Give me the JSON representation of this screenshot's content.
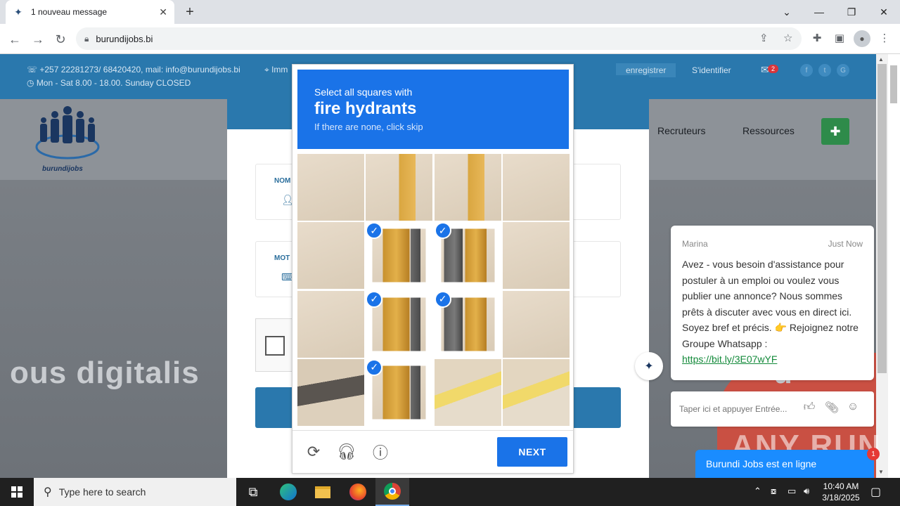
{
  "browser": {
    "tab_title": "1 nouveau message",
    "url": "burundijobs.bi"
  },
  "site": {
    "contact_line1": "+257 22281273/ 68420420, mail: info@burundijobs.bi",
    "contact_line2": "Mon - Sat 8.00 - 18.00. Sunday CLOSED",
    "address_prefix": "Imm",
    "register": "enregistrer",
    "login": "S'identifier",
    "message_count": "2",
    "logo_text": "burundijobs",
    "nav": [
      "Recruteurs",
      "Ressources"
    ],
    "hero_left": "ous digitalis",
    "hero_right": "u"
  },
  "login_form": {
    "name_label": "NOM",
    "password_label": "MOT"
  },
  "captcha": {
    "instruction": "Select all squares with",
    "target": "fire hydrants",
    "hint": "If there are none, click skip",
    "next_label": "NEXT",
    "selected_tiles": [
      5,
      6,
      9,
      10,
      13
    ]
  },
  "chat": {
    "agent": "Marina",
    "time": "Just Now",
    "message": "Avez - vous besoin d'assistance pour postuler à un emploi ou voulez vous publier une annonce? Nous sommes prêts à discuter avec vous en direct ici. Soyez bref et précis. 👉 Rejoignez notre Groupe Whatsapp :",
    "link": "https://bit.ly/3E07wYF",
    "input_placeholder": "Taper ici et appuyer Entrée...",
    "status": "Burundi Jobs est en ligne",
    "badge": "1"
  },
  "watermark": "ANY RUN",
  "taskbar": {
    "search_placeholder": "Type here to search",
    "time": "10:40 AM",
    "date": "3/18/2025"
  }
}
